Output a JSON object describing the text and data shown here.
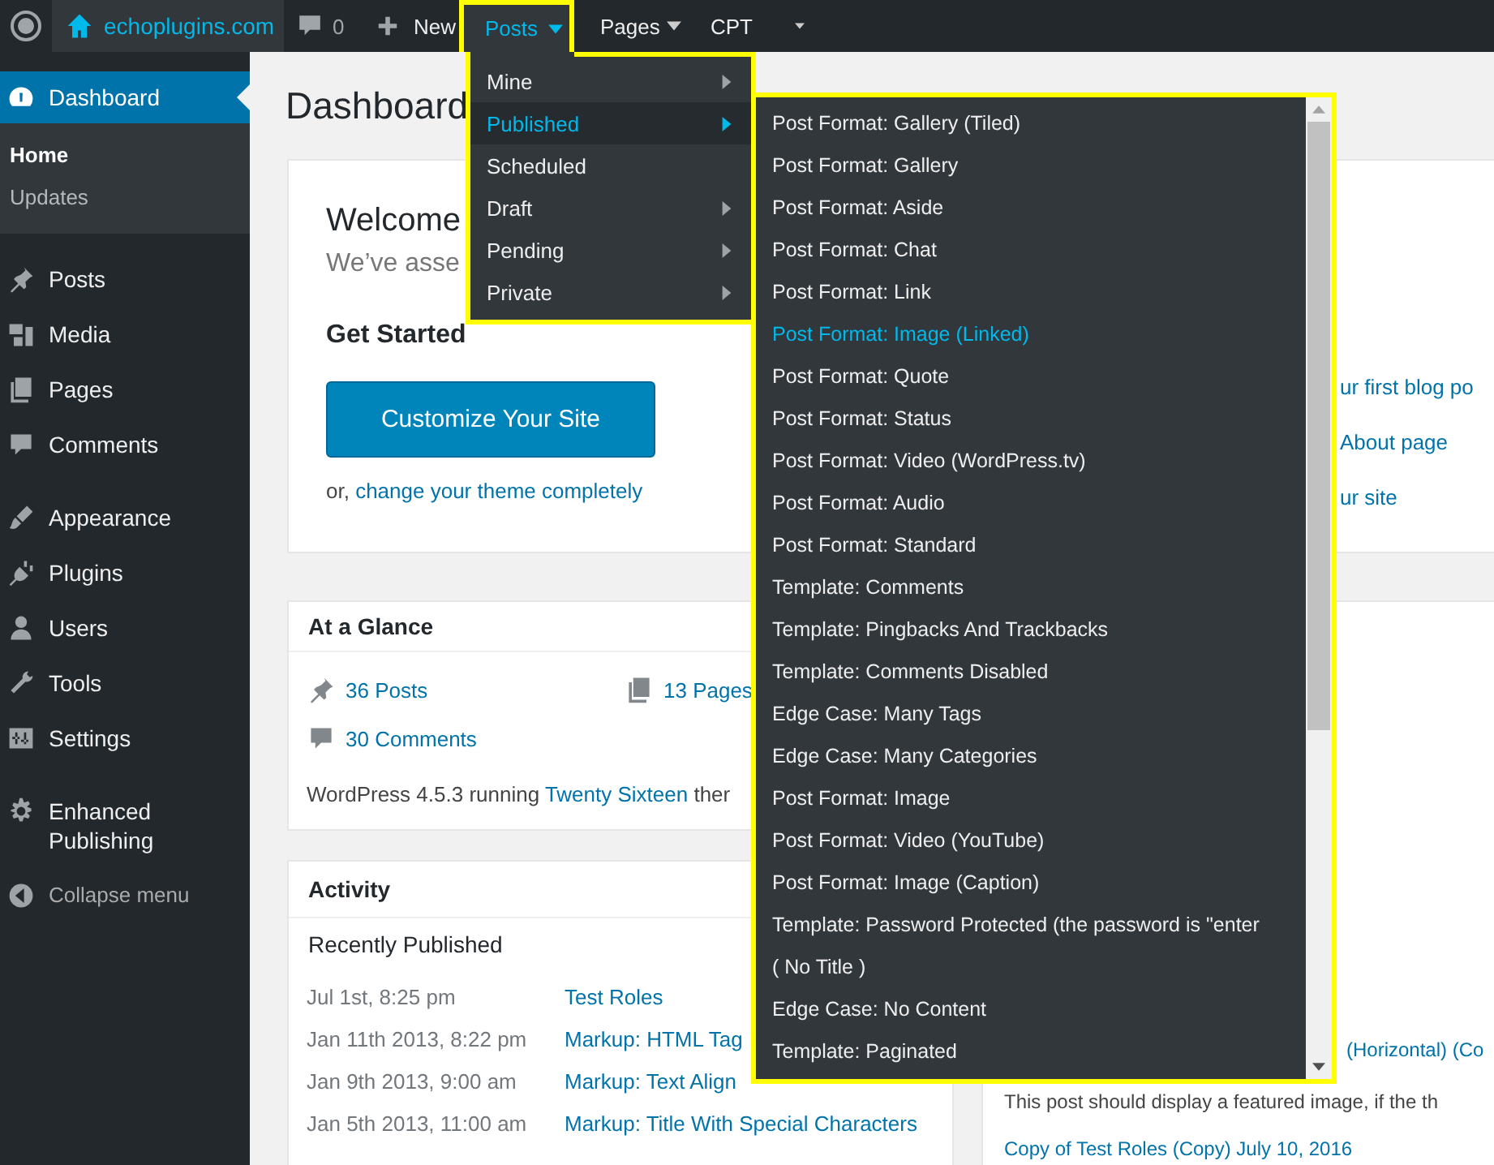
{
  "admin_bar": {
    "site": "echoplugins.com",
    "comments_count": "0",
    "new_label": "New",
    "menus": [
      {
        "label": "Posts",
        "selected": true
      },
      {
        "label": "Pages",
        "selected": false
      },
      {
        "label": "CPT",
        "selected": false
      }
    ]
  },
  "posts_menu": {
    "items": [
      {
        "label": "Mine",
        "has_submenu": true,
        "selected": false
      },
      {
        "label": "Published",
        "has_submenu": true,
        "selected": true
      },
      {
        "label": "Scheduled",
        "has_submenu": false,
        "selected": false
      },
      {
        "label": "Draft",
        "has_submenu": true,
        "selected": false
      },
      {
        "label": "Pending",
        "has_submenu": true,
        "selected": false
      },
      {
        "label": "Private",
        "has_submenu": true,
        "selected": false
      }
    ]
  },
  "published_submenu": {
    "items": [
      {
        "label": "Post Format: Gallery (Tiled)",
        "selected": false
      },
      {
        "label": "Post Format: Gallery",
        "selected": false
      },
      {
        "label": "Post Format: Aside",
        "selected": false
      },
      {
        "label": "Post Format: Chat",
        "selected": false
      },
      {
        "label": "Post Format: Link",
        "selected": false
      },
      {
        "label": "Post Format: Image (Linked)",
        "selected": true
      },
      {
        "label": "Post Format: Quote",
        "selected": false
      },
      {
        "label": "Post Format: Status",
        "selected": false
      },
      {
        "label": "Post Format: Video (WordPress.tv)",
        "selected": false
      },
      {
        "label": "Post Format: Audio",
        "selected": false
      },
      {
        "label": "Post Format: Standard",
        "selected": false
      },
      {
        "label": "Template: Comments",
        "selected": false
      },
      {
        "label": "Template: Pingbacks And Trackbacks",
        "selected": false
      },
      {
        "label": "Template: Comments Disabled",
        "selected": false
      },
      {
        "label": "Edge Case: Many Tags",
        "selected": false
      },
      {
        "label": "Edge Case: Many Categories",
        "selected": false
      },
      {
        "label": "Post Format: Image",
        "selected": false
      },
      {
        "label": "Post Format: Video (YouTube)",
        "selected": false
      },
      {
        "label": "Post Format: Image (Caption)",
        "selected": false
      },
      {
        "label": "Template: Password Protected (the password is \"enter",
        "selected": false
      },
      {
        "label": "( No Title )",
        "selected": false
      },
      {
        "label": "Edge Case: No Content",
        "selected": false
      },
      {
        "label": "Template: Paginated",
        "selected": false
      }
    ]
  },
  "sidebar": {
    "groups": [
      [
        {
          "label": "Dashboard",
          "selected": true,
          "children": [
            {
              "label": "Home",
              "selected": true
            },
            {
              "label": "Updates",
              "selected": false
            }
          ]
        }
      ],
      [
        {
          "label": "Posts",
          "selected": false
        },
        {
          "label": "Media",
          "selected": false
        },
        {
          "label": "Pages",
          "selected": false
        },
        {
          "label": "Comments",
          "selected": false
        }
      ],
      [
        {
          "label": "Appearance",
          "selected": false
        },
        {
          "label": "Plugins",
          "selected": false
        },
        {
          "label": "Users",
          "selected": false
        },
        {
          "label": "Tools",
          "selected": false
        },
        {
          "label": "Settings",
          "selected": false
        }
      ],
      [
        {
          "label": "Enhanced Publishing",
          "selected": false
        }
      ]
    ],
    "collapse_label": "Collapse menu"
  },
  "page_title": "Dashboard",
  "welcome": {
    "title": "Welcome",
    "subtitle": "We’ve asse",
    "get_started": "Get Started",
    "button": "Customize Your Site",
    "alt_prefix": "or, ",
    "alt_link": "change your theme completely",
    "next_steps": [
      "ur first blog po",
      "About page",
      "ur site"
    ]
  },
  "at_a_glance": {
    "title": "At a Glance",
    "posts": "36 Posts",
    "pages": "13 Pages",
    "comments": "30 Comments",
    "version_text": "WordPress 4.5.3 running ",
    "theme_link": "Twenty Sixteen",
    "theme_suffix": " ther"
  },
  "activity": {
    "title": "Activity",
    "section": "Recently Published",
    "rows": [
      {
        "date": "Jul 1st, 8:25 pm",
        "title": "Test Roles"
      },
      {
        "date": "Jan 11th 2013, 8:22 pm",
        "title": "Markup: HTML Tag"
      },
      {
        "date": "Jan 9th 2013, 9:00 am",
        "title": "Markup: Text Align"
      },
      {
        "date": "Jan 5th 2013, 11:00 am",
        "title": "Markup: Title With Special Characters"
      }
    ]
  },
  "right_column": {
    "comment_tail": "(Horizontal) (Co",
    "excerpt": "This post should display a featured image, if the th",
    "draft_link": "Copy of Test Roles (Copy) July 10, 2016"
  }
}
